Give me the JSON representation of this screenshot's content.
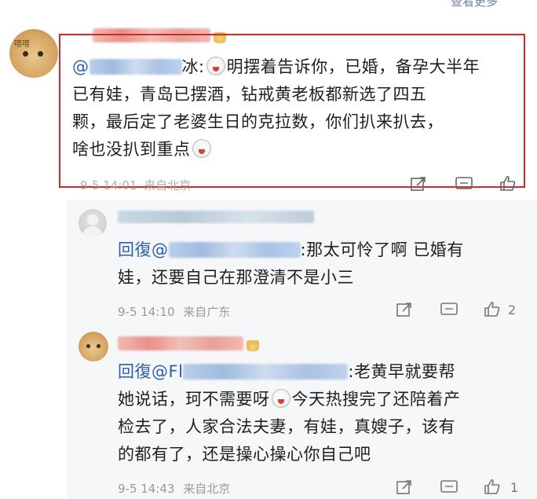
{
  "top_right": {
    "text": "查看更多"
  },
  "main_comment": {
    "avatar_label": "嘻嘻",
    "mention_suffix": "冰:",
    "lines": [
      "明摆着告诉你，已婚，备孕大半年",
      "已有娃，青岛已摆酒，钻戒黄老板都新选了四五",
      "颗，最后定了老婆生日的克拉数，你们扒来扒去，",
      "啥也没扒到重点"
    ],
    "timestamp": "9-5 14:01",
    "location": "来自北京",
    "like_count": ""
  },
  "reply1": {
    "reply_prefix": "回復@",
    "lines": [
      ":那太可怜了啊 已婚有",
      "娃，还要自己在那澄清不是小三"
    ],
    "timestamp": "9-5 14:10",
    "location": "来自广东",
    "like_count": "2"
  },
  "reply2": {
    "reply_prefix": "回復@Fl",
    "lines": [
      ":老黄早就要帮",
      "她说话，珂不需要呀",
      "今天热搜完了还陪着产",
      "检去了，人家合法夫妻，有娃，真嫂子，该有",
      "的都有了，还是操心操心你自己吧"
    ],
    "timestamp": "9-5 14:43",
    "location": "来自北京",
    "like_count": "1"
  },
  "colors": {
    "highlight_border": "#d7282c",
    "mention": "#2d5fa8",
    "meta": "#9a9a9a"
  },
  "icons": [
    "share-icon",
    "comment-icon",
    "like-icon",
    "laugh-emoji-icon",
    "crown-badge-icon"
  ]
}
